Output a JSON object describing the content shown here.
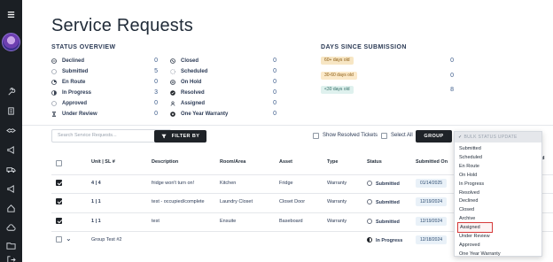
{
  "page": {
    "title": "Service Requests"
  },
  "status_overview": {
    "heading": "STATUS OVERVIEW",
    "left": [
      {
        "label": "Declined",
        "value": "0",
        "icon": "declined-icon"
      },
      {
        "label": "Submitted",
        "value": "5",
        "icon": "submitted-icon"
      },
      {
        "label": "En Route",
        "value": "0",
        "icon": "en-route-icon"
      },
      {
        "label": "In Progress",
        "value": "3",
        "icon": "in-progress-icon"
      },
      {
        "label": "Approved",
        "value": "0",
        "icon": "approved-icon"
      },
      {
        "label": "Under Review",
        "value": "0",
        "icon": "under-review-icon"
      }
    ],
    "right": [
      {
        "label": "Closed",
        "value": "0",
        "icon": "closed-icon"
      },
      {
        "label": "Scheduled",
        "value": "0",
        "icon": "scheduled-icon"
      },
      {
        "label": "On Hold",
        "value": "0",
        "icon": "on-hold-icon"
      },
      {
        "label": "Resolved",
        "value": "0",
        "icon": "resolved-icon"
      },
      {
        "label": "Assigned",
        "value": "0",
        "icon": "assigned-icon"
      },
      {
        "label": "One Year Warranty",
        "value": "0",
        "icon": "warranty-icon"
      }
    ]
  },
  "days_since": {
    "heading": "DAYS SINCE SUBMISSION",
    "items": [
      {
        "label": "60+ days old",
        "value": "0",
        "color": "#f7e6c4",
        "text_color": "#8a5a12"
      },
      {
        "label": "30-60 days old",
        "value": "0",
        "color": "#fbe9c9",
        "text_color": "#8a5a12"
      },
      {
        "label": "<30 days old",
        "value": "8",
        "color": "#dff1ee",
        "text_color": "#2f6b63"
      }
    ]
  },
  "toolbar": {
    "search_placeholder": "Search Service Requests...",
    "filter_label": "FILTER BY",
    "show_resolved_label": "Show Resolved Tickets",
    "select_all_label": "Select All",
    "group_label": "GROUP"
  },
  "table": {
    "columns": [
      "Unit | SL #",
      "Description",
      "Room/Area",
      "Asset",
      "Type",
      "Status",
      "Submitted On",
      "Sched Date/"
    ],
    "rows": [
      {
        "checked": true,
        "unit": "4 | 4",
        "description": "fridge won't turn on!",
        "room": "Kitchen",
        "asset": "Fridge",
        "type": "Warranty",
        "status": "Submitted",
        "status_icon": "submitted-icon",
        "submitted_on": "01/14/2025"
      },
      {
        "checked": true,
        "unit": "1 | 1",
        "description": "test - occupied/complete",
        "room": "Laundry Closet",
        "asset": "Closet Door",
        "type": "Warranty",
        "status": "Submitted",
        "status_icon": "submitted-icon",
        "submitted_on": "12/19/2024"
      },
      {
        "checked": true,
        "unit": "1 | 1",
        "description": "test",
        "room": "Ensuite",
        "asset": "Baseboard",
        "type": "Warranty",
        "status": "Submitted",
        "status_icon": "submitted-icon",
        "submitted_on": "12/19/2024"
      },
      {
        "checked": false,
        "unit": "Group Test #2",
        "description": "",
        "room": "",
        "asset": "",
        "type": "",
        "status": "In Progress",
        "status_icon": "in-progress-icon",
        "submitted_on": "12/18/2024"
      }
    ]
  },
  "bulk_status": {
    "placeholder": "BULK STATUS UPDATE",
    "options": [
      "Submitted",
      "Scheduled",
      "En Route",
      "On Hold",
      "In Progress",
      "Resolved",
      "Declined",
      "Closed",
      "Archive",
      "Assigned",
      "Under Review",
      "Approved",
      "One Year Warranty"
    ],
    "highlighted": "Assigned"
  },
  "sidebar": {
    "items": [
      "menu-icon",
      "wrench-icon",
      "building-icon",
      "handshake-icon",
      "megaphone-icon",
      "truck-icon",
      "megaphone-icon",
      "home-icon",
      "cloud-icon",
      "folder-icon",
      "signout-icon"
    ]
  }
}
